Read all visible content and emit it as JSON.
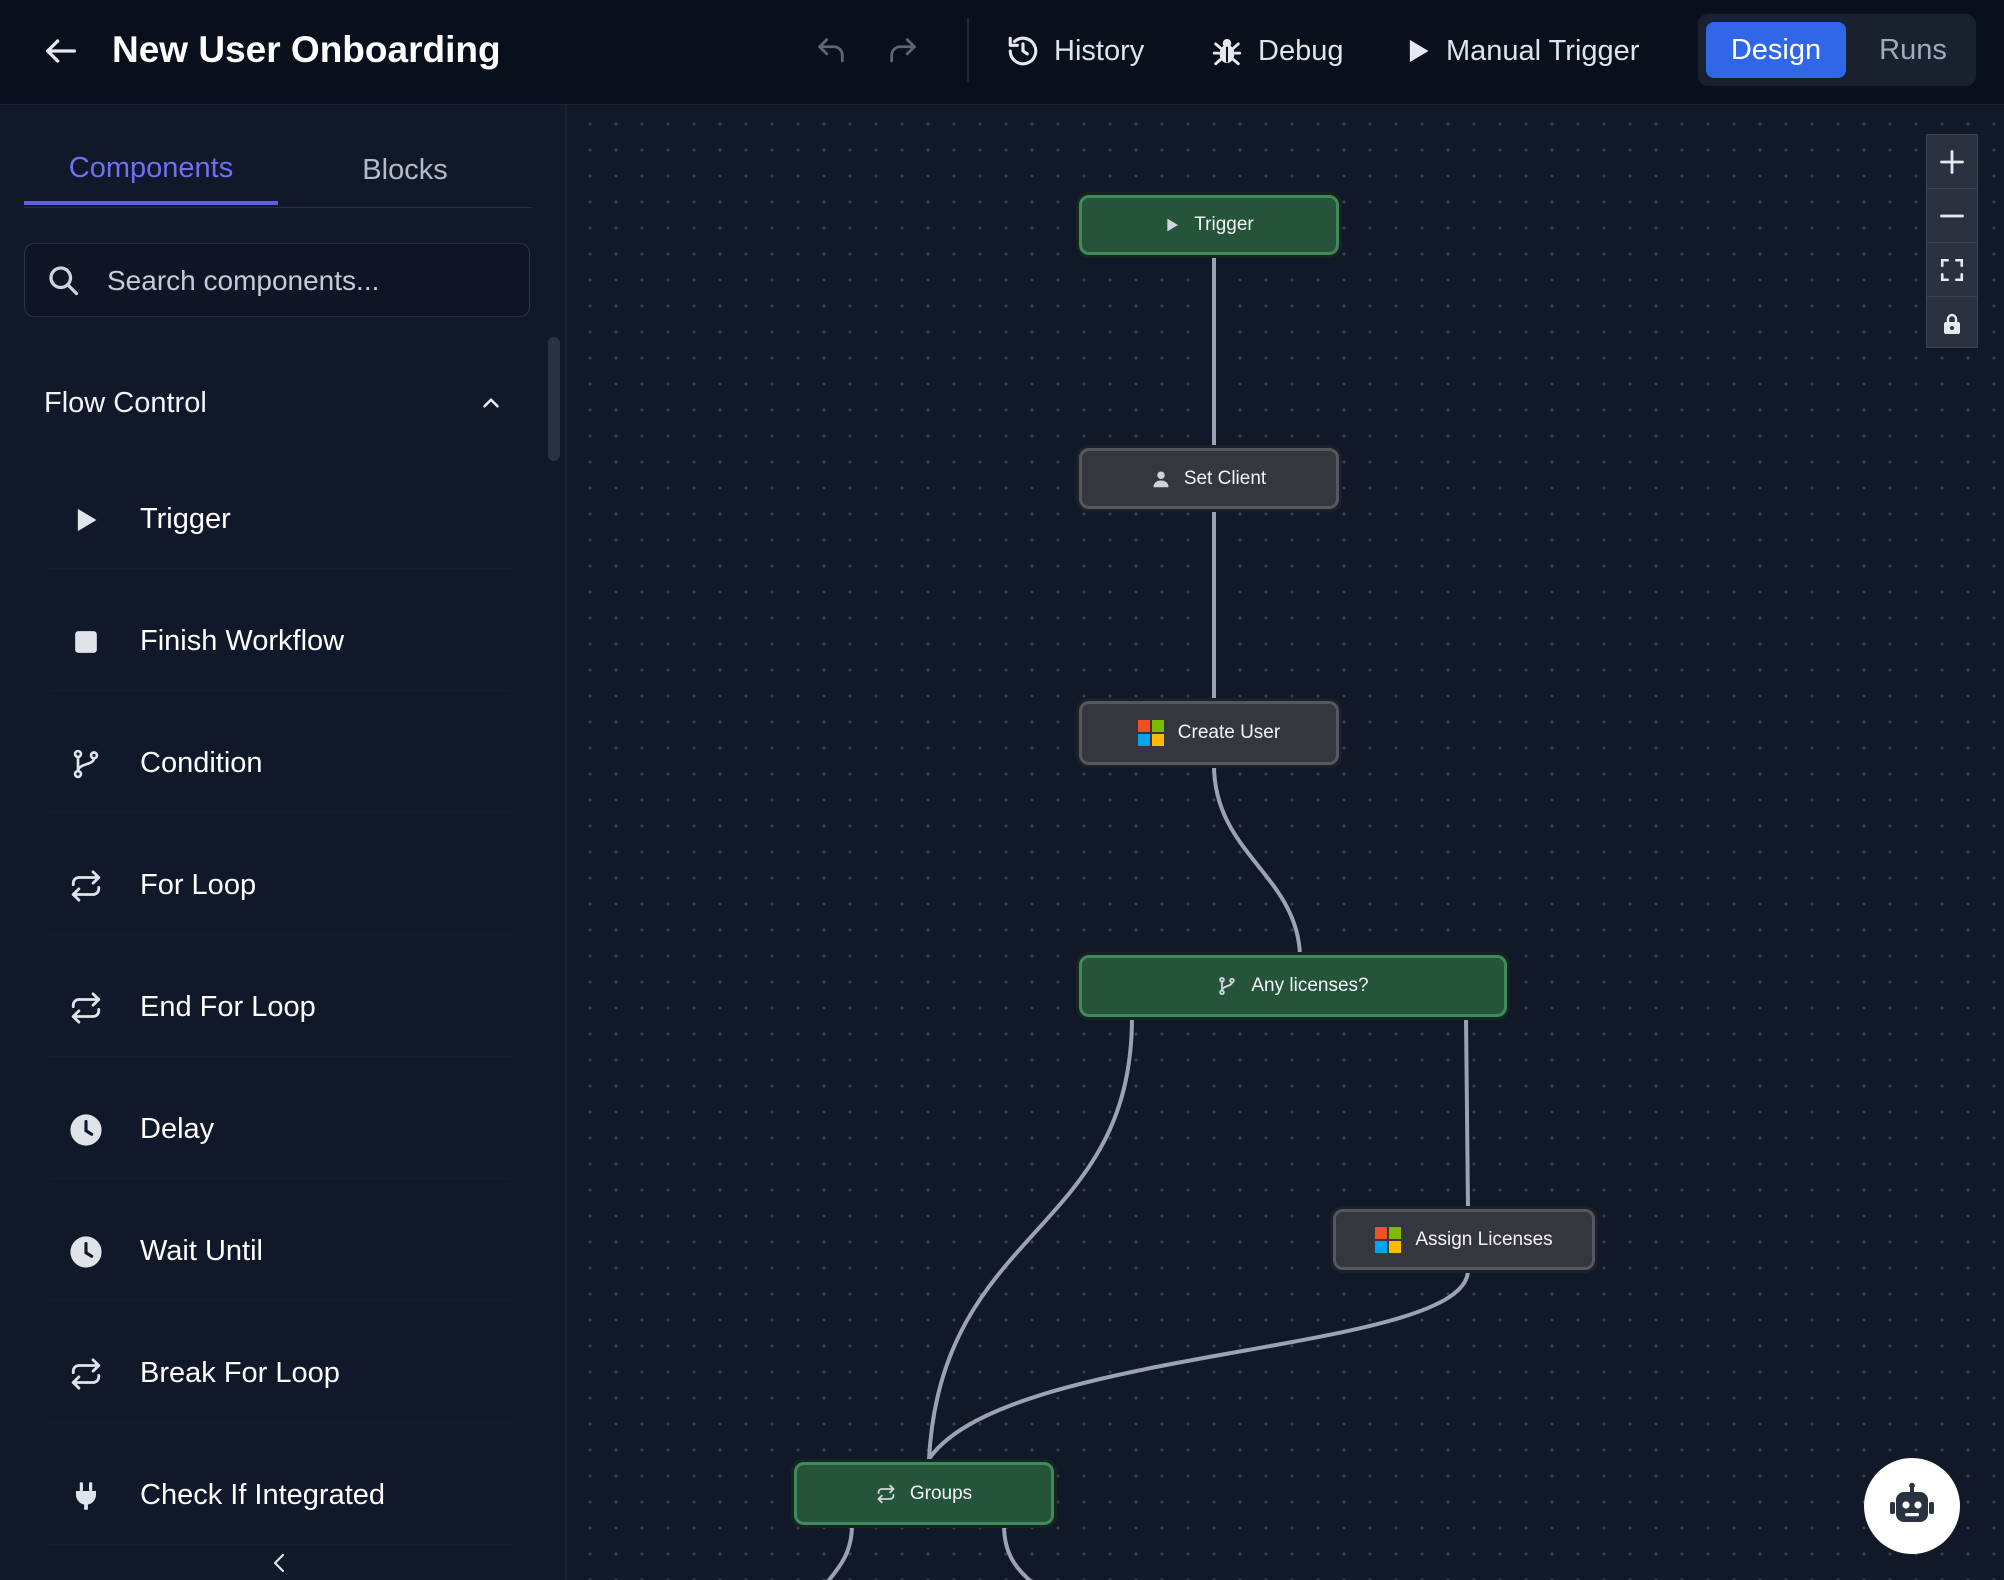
{
  "header": {
    "title": "New User Onboarding",
    "actions": {
      "history": "History",
      "debug": "Debug",
      "manual_trigger": "Manual Trigger"
    },
    "view_toggle": {
      "design": "Design",
      "runs": "Runs",
      "active": "Design"
    }
  },
  "sidebar": {
    "tabs": [
      {
        "label": "Components",
        "active": true
      },
      {
        "label": "Blocks",
        "active": false
      }
    ],
    "search": {
      "placeholder": "Search components...",
      "value": ""
    },
    "section": {
      "title": "Flow Control",
      "expanded": true
    },
    "items": [
      {
        "label": "Trigger",
        "icon": "play-icon"
      },
      {
        "label": "Finish Workflow",
        "icon": "stop-icon"
      },
      {
        "label": "Condition",
        "icon": "branch-icon"
      },
      {
        "label": "For Loop",
        "icon": "loop-icon"
      },
      {
        "label": "End For Loop",
        "icon": "loop-icon"
      },
      {
        "label": "Delay",
        "icon": "clock-icon"
      },
      {
        "label": "Wait Until",
        "icon": "clock-icon"
      },
      {
        "label": "Break For Loop",
        "icon": "loop-icon"
      },
      {
        "label": "Check If Integrated",
        "icon": "plug-icon"
      }
    ]
  },
  "canvas": {
    "nodes": [
      {
        "label": "Trigger",
        "icon": "play-icon",
        "style": "green"
      },
      {
        "label": "Set Client",
        "icon": "user-icon",
        "style": "grey"
      },
      {
        "label": "Create User",
        "icon": "microsoft-icon",
        "style": "grey"
      },
      {
        "label": "Any licenses?",
        "icon": "branch-icon",
        "style": "green"
      },
      {
        "label": "Assign Licenses",
        "icon": "microsoft-icon",
        "style": "grey"
      },
      {
        "label": "Groups",
        "icon": "loop-icon",
        "style": "green"
      }
    ]
  },
  "colors": {
    "accent": "#2f67e8",
    "tab_active": "#5b5fe8",
    "node_green": "#25543b",
    "node_grey": "#34373d",
    "edge": "#9aa3b5"
  }
}
